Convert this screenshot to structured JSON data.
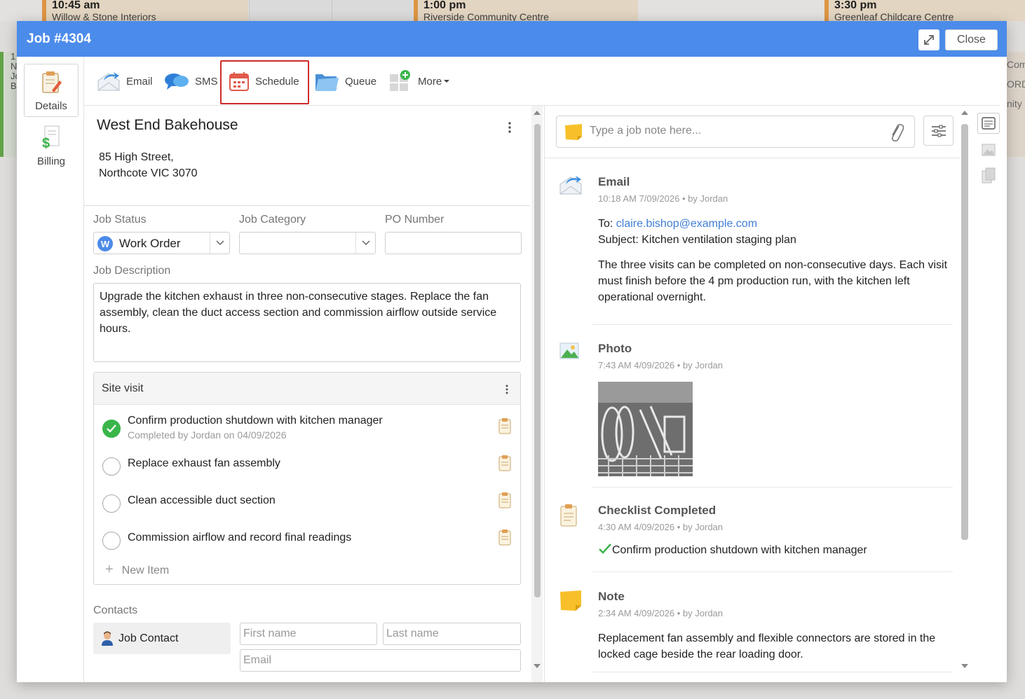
{
  "background": {
    "events": [
      {
        "time": "10:45 am",
        "name": "Willow & Stone Interiors"
      },
      {
        "time": "1:00 pm",
        "name": "Riverside Community Centre"
      },
      {
        "time": "3:30 pm",
        "name": "Greenleaf Childcare Centre"
      }
    ],
    "left_fragments": [
      "1",
      "N",
      "Jc",
      "B"
    ],
    "right_fragments": [
      "Com",
      "ORD",
      "nity C"
    ]
  },
  "modal": {
    "title": "Job #4304",
    "close_label": "Close"
  },
  "side_nav": [
    {
      "label": "Details",
      "icon": "notepad-icon",
      "active": true
    },
    {
      "label": "Billing",
      "icon": "billing-icon",
      "active": false
    }
  ],
  "toolbar": {
    "email": "Email",
    "sms": "SMS",
    "schedule": "Schedule",
    "queue": "Queue",
    "more": "More"
  },
  "job": {
    "company": "West End Bakehouse",
    "address_line1": "85 High Street,",
    "address_line2": "Northcote VIC 3070",
    "status_label": "Job Status",
    "status_value": "Work Order",
    "status_badge": "W",
    "category_label": "Job Category",
    "category_value": "",
    "po_label": "PO Number",
    "po_value": "",
    "description_label": "Job Description",
    "description": "Upgrade the kitchen exhaust in three non-consecutive stages. Replace the fan assembly, clean the duct access section and commission airflow outside service hours."
  },
  "checklist": {
    "title": "Site visit",
    "items": [
      {
        "text": "Confirm production shutdown with kitchen manager",
        "done": true,
        "sub": "Completed by Jordan on 04/09/2026"
      },
      {
        "text": "Replace exhaust fan assembly",
        "done": false,
        "sub": ""
      },
      {
        "text": "Clean accessible duct section",
        "done": false,
        "sub": ""
      },
      {
        "text": "Commission airflow and record final readings",
        "done": false,
        "sub": ""
      }
    ],
    "new_item": "New Item"
  },
  "contacts": {
    "label": "Contacts",
    "chip": "Job Contact",
    "first_name_placeholder": "First name",
    "last_name_placeholder": "Last name",
    "email_placeholder": "Email"
  },
  "notes": {
    "placeholder": "Type a job note here..."
  },
  "activity": [
    {
      "type": "Email",
      "meta": "10:18 AM 7/09/2026 •  by Jordan",
      "to_label": "To:",
      "to": "claire.bishop@example.com",
      "subject": "Subject: Kitchen ventilation staging plan",
      "body": "The three visits can be completed on non-consecutive days. Each visit must finish before the 4 pm production run, with the kitchen left operational overnight."
    },
    {
      "type": "Photo",
      "meta": "7:43 AM 4/09/2026 •  by Jordan"
    },
    {
      "type": "Checklist Completed",
      "meta": "4:30 AM 4/09/2026 •  by Jordan",
      "item": "Confirm production shutdown with kitchen manager"
    },
    {
      "type": "Note",
      "meta": "2:34 AM 4/09/2026 •  by Jordan",
      "body": "Replacement fan assembly and flexible connectors are stored in the locked cage beside the rear loading door."
    }
  ],
  "colors": {
    "header": "#4b8bea",
    "highlight": "#cc2b2b",
    "success": "#3ab54a",
    "link": "#3f7ed6"
  }
}
